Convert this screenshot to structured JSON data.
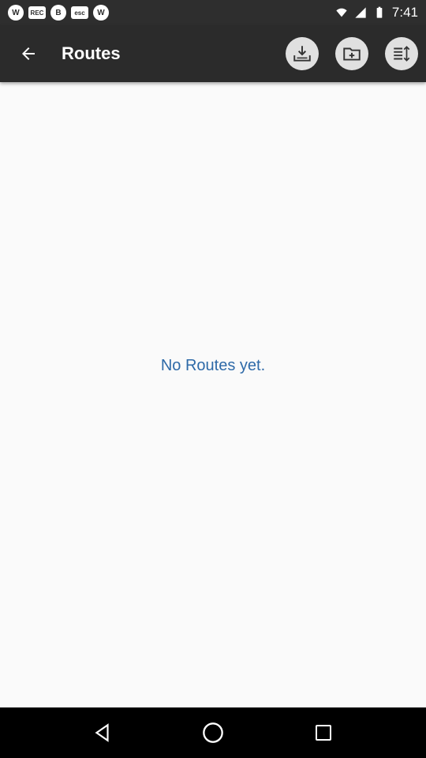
{
  "status_bar": {
    "time": "7:41",
    "notifications": [
      "W",
      "REC",
      "B",
      "esc",
      "W"
    ]
  },
  "app_bar": {
    "title": "Routes",
    "actions": [
      "download-icon",
      "new-folder-icon",
      "sort-icon"
    ]
  },
  "main": {
    "empty_message": "No Routes yet."
  },
  "colors": {
    "app_bar": "#2b2b2b",
    "status_bar": "#2e2e2e",
    "empty_text": "#2e6aa8",
    "background": "#fafafa"
  }
}
